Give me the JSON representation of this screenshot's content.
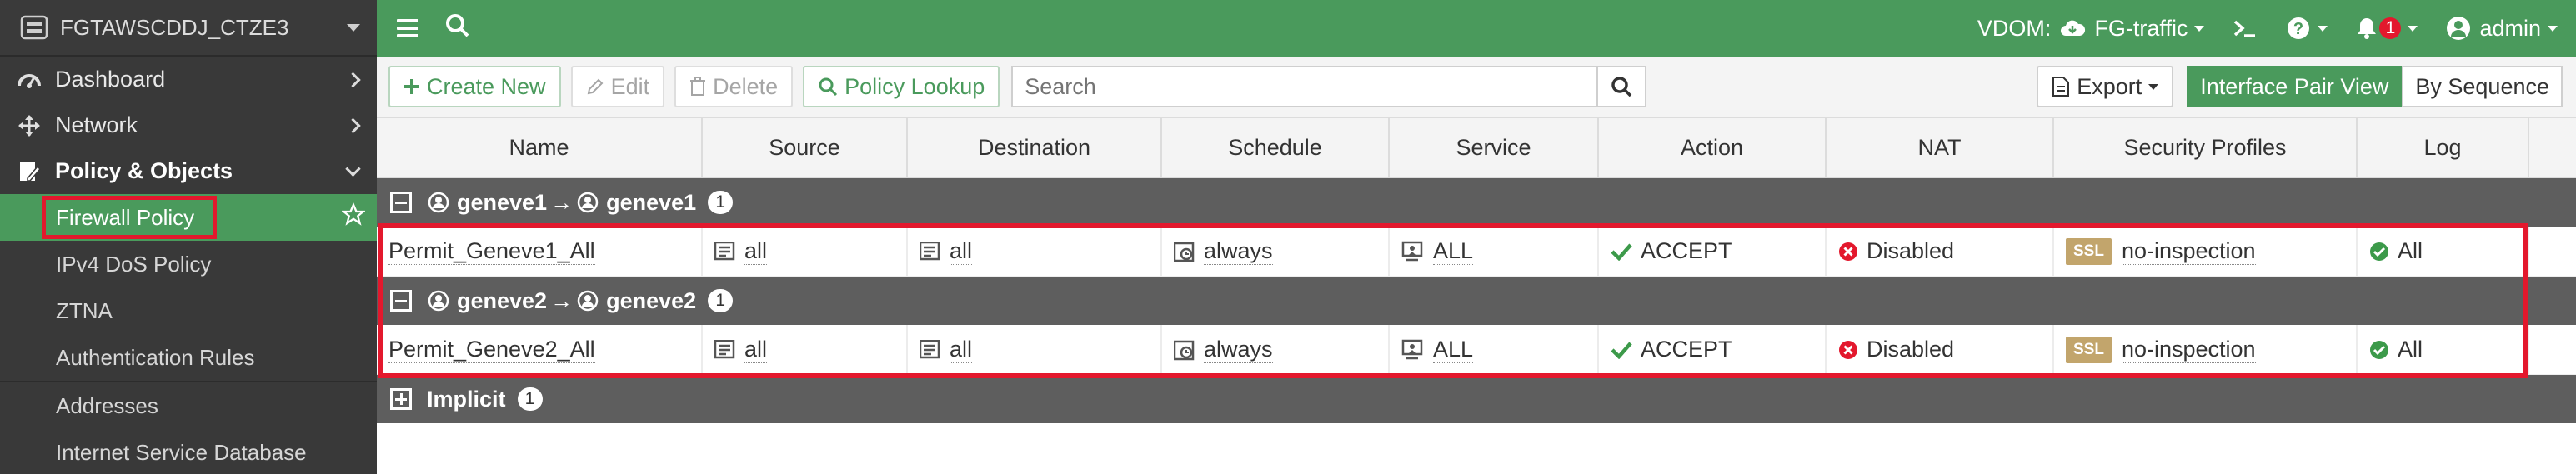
{
  "device": {
    "name": "FGTAWSCDDJ_CTZE3"
  },
  "sidebar": {
    "items": [
      {
        "label": "Dashboard"
      },
      {
        "label": "Network"
      },
      {
        "label": "Policy & Objects"
      }
    ],
    "subitems": [
      {
        "label": "Firewall Policy"
      },
      {
        "label": "IPv4 DoS Policy"
      },
      {
        "label": "ZTNA"
      },
      {
        "label": "Authentication Rules"
      },
      {
        "label": "Addresses"
      },
      {
        "label": "Internet Service Database"
      }
    ]
  },
  "topbar": {
    "vdom_label": "VDOM:",
    "vdom_value": "FG-traffic",
    "notification_count": "1",
    "user": "admin"
  },
  "toolbar": {
    "create_new": "Create New",
    "edit": "Edit",
    "delete": "Delete",
    "policy_lookup": "Policy Lookup",
    "search_placeholder": "Search",
    "export": "Export",
    "view_interface_pair": "Interface Pair View",
    "view_by_sequence": "By Sequence"
  },
  "table": {
    "columns": [
      "Name",
      "Source",
      "Destination",
      "Schedule",
      "Service",
      "Action",
      "NAT",
      "Security Profiles",
      "Log"
    ],
    "groups": [
      {
        "from": "geneve1",
        "to": "geneve1",
        "arrow": "→",
        "count": "1",
        "row": {
          "name": "Permit_Geneve1_All",
          "source": "all",
          "destination": "all",
          "schedule": "always",
          "service": "ALL",
          "action": "ACCEPT",
          "nat": "Disabled",
          "ssl": "SSL",
          "profile": "no-inspection",
          "log": "All"
        }
      },
      {
        "from": "geneve2",
        "to": "geneve2",
        "arrow": "→",
        "count": "1",
        "row": {
          "name": "Permit_Geneve2_All",
          "source": "all",
          "destination": "all",
          "schedule": "always",
          "service": "ALL",
          "action": "ACCEPT",
          "nat": "Disabled",
          "ssl": "SSL",
          "profile": "no-inspection",
          "log": "All"
        }
      }
    ],
    "implicit": {
      "label": "Implicit",
      "count": "1"
    }
  },
  "colors": {
    "accent": "#4a9a5c",
    "highlight": "#e3182d",
    "group_bg": "#5e5e5e",
    "ssl_badge": "#c2a56c"
  },
  "icons": [
    "menu-icon",
    "search-icon",
    "cloud-icon",
    "terminal-icon",
    "help-icon",
    "bell-icon",
    "user-icon",
    "dashboard-icon",
    "network-icon",
    "policy-icon",
    "star-icon",
    "plus-icon",
    "pencil-icon",
    "trash-icon",
    "export-icon",
    "interface-icon",
    "address-icon",
    "schedule-icon",
    "service-icon",
    "check-icon",
    "x-circle-icon",
    "check-circle-icon"
  ]
}
